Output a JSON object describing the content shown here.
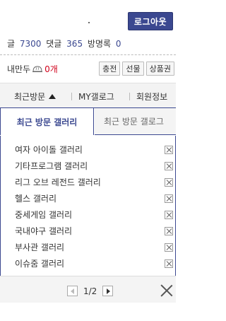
{
  "header": {
    "logout_label": "로그아웃",
    "stats": {
      "posts_label": "글",
      "posts": "7300",
      "comments_label": "댓글",
      "comments": "365",
      "guestbook_label": "방명록",
      "guestbook": "0"
    }
  },
  "coins": {
    "label": "내만두",
    "icon": "dumpling-icon",
    "value": "0개",
    "buttons": [
      "충전",
      "선물",
      "상품권"
    ]
  },
  "tabs": {
    "recent": "최근방문",
    "my_gallery": "MY갤로그",
    "member_info": "회원정보"
  },
  "subtabs": {
    "active": "최근 방문 갤러리",
    "inactive": "최근 방문 갤로그"
  },
  "gallery_list": [
    "여자 아이돌 갤러리",
    "기타프로그램 갤러리",
    "리그 오브 레전드 갤러리",
    "헬스 갤러리",
    "중세게임 갤러리",
    "국내야구 갤러리",
    "부사관 갤러리",
    "이슈줌 갤러리"
  ],
  "pagination": {
    "page_text": "1/2"
  },
  "colors": {
    "accent": "#3b4890",
    "coin_value": "#d0021b"
  }
}
